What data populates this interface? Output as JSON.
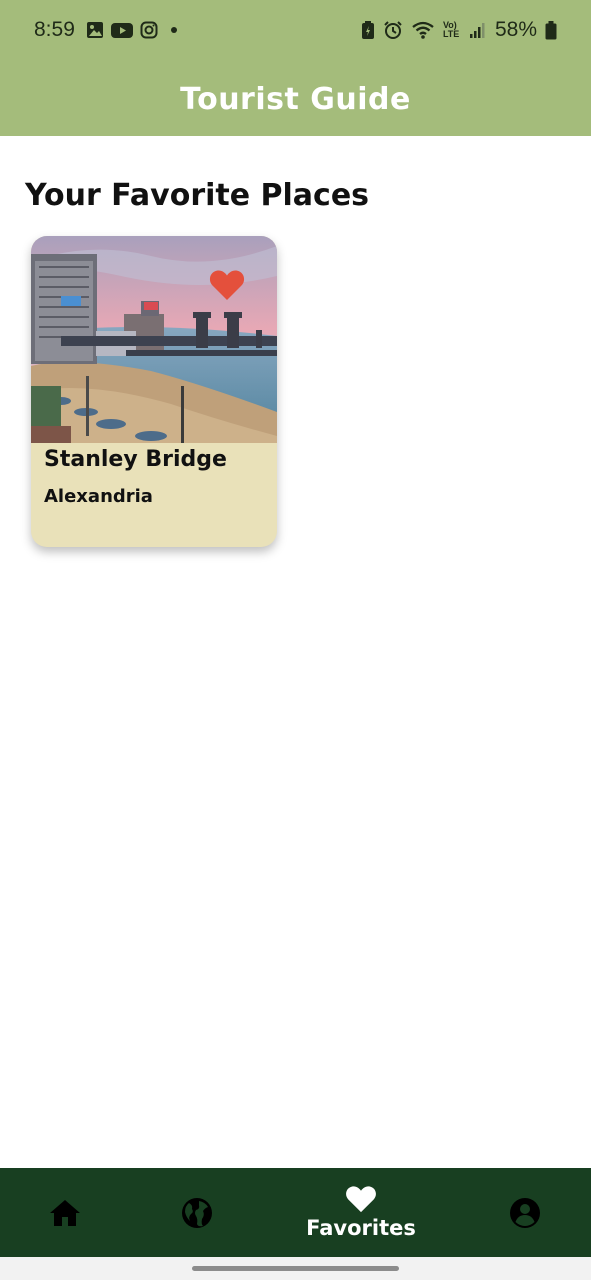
{
  "status": {
    "time": "8:59",
    "battery_text": "58%",
    "network_text": "Vo) LTE",
    "icons": [
      "gallery-icon",
      "youtube-icon",
      "instagram-icon",
      "dot-icon",
      "battery-saver-icon",
      "alarm-icon",
      "wifi-icon",
      "signal-icon",
      "battery-icon"
    ]
  },
  "app": {
    "title": "Tourist Guide"
  },
  "page": {
    "heading": "Your Favorite Places"
  },
  "favorites": [
    {
      "name": "Stanley Bridge",
      "city": "Alexandria",
      "favorited": true,
      "image": "stanley-bridge-photo"
    }
  ],
  "bottom_nav": {
    "items": [
      {
        "name": "home",
        "icon": "home-icon",
        "label": ""
      },
      {
        "name": "explore",
        "icon": "globe-icon",
        "label": ""
      },
      {
        "name": "favorites",
        "icon": "heart-icon",
        "label": "Favorites",
        "active": true
      },
      {
        "name": "profile",
        "icon": "account-icon",
        "label": ""
      }
    ]
  },
  "colors": {
    "app_bar": "#a4bc7b",
    "card_background": "#e9e1b9",
    "bottom_nav": "#183f21",
    "heart": "#e4503c"
  }
}
